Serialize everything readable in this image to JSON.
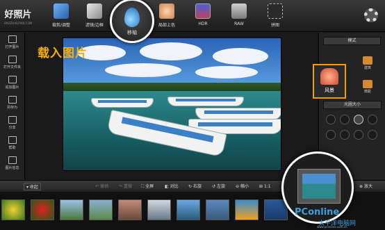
{
  "app": {
    "logo_title": "好照片",
    "logo_sub": "HAOZHAOPIAN.COM"
  },
  "toolbar": {
    "crop": "裁剪/调整",
    "filter": "滤镜/边框",
    "tilt_shift": "移轴",
    "colorize": "局部上色",
    "hdr": "HDR",
    "raw": "RAW",
    "layout": "拼图"
  },
  "sidebar": {
    "open_image": "打开图片",
    "open_folder": "打开文件夹",
    "add_image": "追加图片",
    "save_as": "另存为",
    "share": "分享",
    "help": "帮助",
    "image_info": "图片信息"
  },
  "overlay_title": "载入图片",
  "right_panel": {
    "mode_label": "模式",
    "scene_label": "风景",
    "building_label": "建筑",
    "micro_label": "微距",
    "aperture_label": "光圈大小"
  },
  "bottom_bar": {
    "collapse": "收起",
    "undo": "撤销",
    "redo": "重做",
    "fullscreen": "全屏",
    "compare": "对比",
    "rotate_right": "右旋",
    "rotate_left": "左旋",
    "zoom_out": "缩小",
    "ratio": "1:1",
    "zoom_in": "放大"
  },
  "watermark": {
    "brand": "PConline",
    "site": "太平洋电脑网",
    "url": "www.pconline.com.cn"
  },
  "colors": {
    "accent": "#f5b000",
    "active_ring": "#ffffff",
    "watermark": "#3aa0e0"
  }
}
